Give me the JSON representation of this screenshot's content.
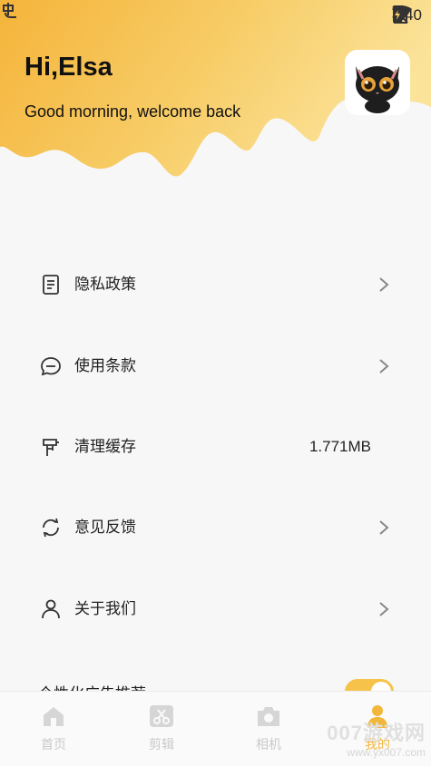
{
  "status_bar": {
    "time": "8:40"
  },
  "header": {
    "greeting": "Hi,Elsa",
    "subtitle": "Good morning, welcome back",
    "gradient_colors": [
      "#f5b43a",
      "#fbe39a"
    ]
  },
  "menu": {
    "items": [
      {
        "label": "隐私政策",
        "icon": "document-icon"
      },
      {
        "label": "使用条款",
        "icon": "chat-icon"
      },
      {
        "label": "清理缓存",
        "icon": "brush-icon",
        "value": "1.771MB"
      },
      {
        "label": "意见反馈",
        "icon": "refresh-icon"
      },
      {
        "label": "关于我们",
        "icon": "person-icon"
      }
    ],
    "partial": {
      "label": "个性化广告推荐",
      "toggle_on": true
    }
  },
  "bottom_nav": {
    "tabs": [
      {
        "label": "首页",
        "icon": "home-icon"
      },
      {
        "label": "剪辑",
        "icon": "scissors-icon"
      },
      {
        "label": "相机",
        "icon": "camera-icon"
      },
      {
        "label": "我的",
        "icon": "profile-icon"
      }
    ],
    "active_index": 3,
    "active_color": "#f2b73a"
  },
  "watermark": {
    "title": "007游戏网",
    "url": "www.yx007.com"
  }
}
